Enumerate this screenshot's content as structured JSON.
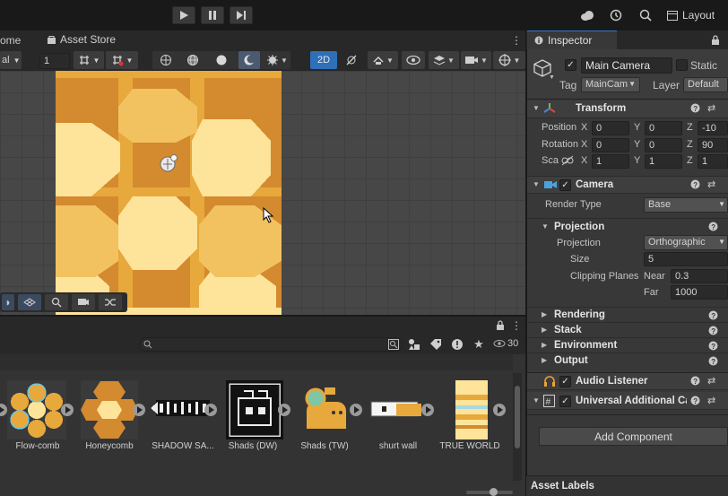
{
  "toolbar": {
    "play_icon": "play-icon",
    "pause_icon": "pause-icon",
    "step_icon": "step-icon",
    "layout_label": "Layout"
  },
  "tabs": {
    "home_partial": "ome",
    "asset_store": "Asset Store",
    "inspector": "Inspector"
  },
  "scene_toolbar": {
    "pivot_partial": "al",
    "grid_value": "1",
    "mode_2d": "2D"
  },
  "inspector": {
    "object_name": "Main Camera",
    "static_label": "Static",
    "tag_label": "Tag",
    "tag_value": "MainCam",
    "layer_label": "Layer",
    "layer_value": "Default",
    "transform": {
      "title": "Transform",
      "position_label": "Position",
      "rotation_label": "Rotation",
      "scale_label": "Sca",
      "position": {
        "x": "0",
        "y": "0",
        "z": "-10"
      },
      "rotation": {
        "x": "0",
        "y": "0",
        "z": "90"
      },
      "scale": {
        "x": "1",
        "y": "1",
        "z": "1"
      }
    },
    "camera": {
      "title": "Camera",
      "render_type_label": "Render Type",
      "render_type_value": "Base",
      "projection_section": "Projection",
      "projection_label": "Projection",
      "projection_value": "Orthographic",
      "size_label": "Size",
      "size_value": "5",
      "clipping_label": "Clipping Planes",
      "near_label": "Near",
      "near_value": "0.3",
      "far_label": "Far",
      "far_value": "1000",
      "sections": [
        "Rendering",
        "Stack",
        "Environment",
        "Output"
      ]
    },
    "audio_listener": "Audio Listener",
    "universal_camera": "Universal Additional Ca",
    "add_component": "Add Component",
    "asset_labels": "Asset Labels"
  },
  "project": {
    "count": "30",
    "assets": [
      "Flow-comb",
      "Honeycomb",
      "SHADOW SA...",
      "Shads (DW)",
      "Shads (TW)",
      "shurt wall",
      "TRUE WORLD"
    ]
  },
  "colors": {
    "accent_blue": "#2f6fb8",
    "honey_dark": "#d48a2e",
    "honey_mid": "#e7a83c",
    "honey_light": "#fde49a"
  }
}
